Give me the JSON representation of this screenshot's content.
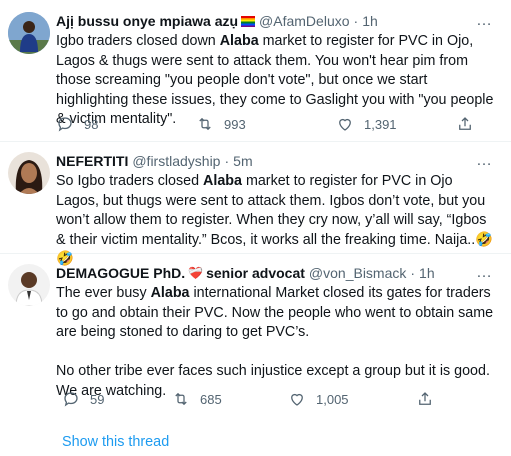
{
  "tweets": [
    {
      "name": "Ajị bussu onye mpiawa azụ",
      "name_badge": "rainbow-flag",
      "handle": "@AfamDeluxo",
      "time": "1h",
      "text_before": "Igbo traders closed down ",
      "text_bold": "Alaba",
      "text_after": " market to register for PVC in Ojo, Lagos & thugs were sent to attack them. You won't hear pim from those screaming \"you people don't vote\", but once we start highlighting these issues, they come to Gaslight you with \"you people & victim mentality\".",
      "replies": "98",
      "retweets": "993",
      "likes": "1,391"
    },
    {
      "name": "NEFERTITI",
      "handle": "@firstladyship",
      "time": "5m",
      "text_before": "So Igbo traders closed ",
      "text_bold": "Alaba",
      "text_after": " market to register for PVC in Ojo Lagos, but thugs were sent to attack them. Igbos don’t vote, but you won’t allow them to register. When they cry now, y’all will say, “Igbos & their victim mentality.” Bcos, it works all the freaking time. Naija..🤣🤣"
    },
    {
      "name": "DEMAGOGUE PhD.",
      "name_badge": "❤️‍🩹",
      "name_suffix": "senior advocat",
      "handle": "@von_Bismack",
      "time": "1h",
      "text_before": "The ever busy ",
      "text_bold": "Alaba",
      "text_after": " international Market closed its gates for traders to go and obtain their PVC. Now the people who went to obtain same are being stoned to daring to get PVC’s.\n\nNo other tribe ever faces such injustice except a group but it is good. We are watching.",
      "replies": "59",
      "retweets": "685",
      "likes": "1,005",
      "show_thread": "Show this thread"
    }
  ],
  "separator": "·",
  "more_icon": "…",
  "colors": {
    "link": "#1d9bf0",
    "muted": "#536471",
    "border": "#eff3f4"
  }
}
